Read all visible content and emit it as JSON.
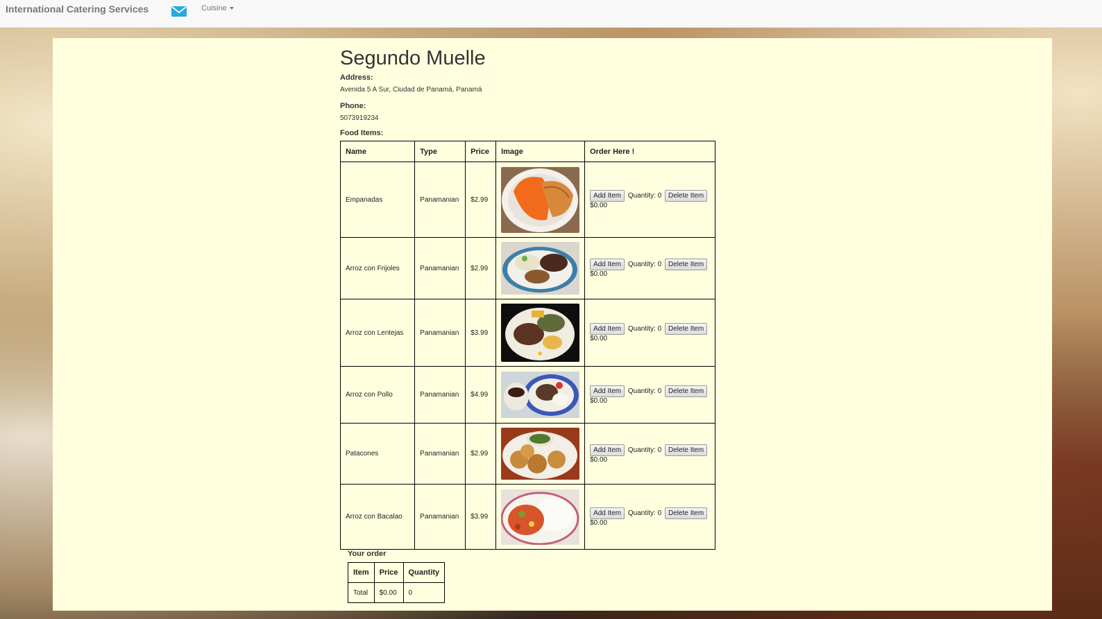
{
  "nav": {
    "brand": "International Catering Services",
    "mail_icon": "envelope-icon",
    "cuisine_label": "Cuisine"
  },
  "restaurant": {
    "name": "Segundo Muelle",
    "address_label": "Address:",
    "address": "Avenida 5 A Sur, Ciudad de Panamá, Panamá",
    "phone_label": "Phone:",
    "phone": "5073919234",
    "food_label": "Food Items:"
  },
  "food_table": {
    "headers": [
      "Name",
      "Type",
      "Price",
      "Image",
      "Order Here !"
    ],
    "add_label": "Add Item",
    "delete_label": "Delete Item",
    "rows": [
      {
        "name": "Empanadas",
        "type": "Panamanian",
        "price": "$2.99",
        "quantity": "Quantity: 0",
        "subtotal": "$0.00"
      },
      {
        "name": "Arroz con Frijoles",
        "type": "Panamanian",
        "price": "$2.99",
        "quantity": "Quantity: 0",
        "subtotal": "$0.00"
      },
      {
        "name": "Arroz con Lentejas",
        "type": "Panamanian",
        "price": "$3.99",
        "quantity": "Quantity: 0",
        "subtotal": "$0.00"
      },
      {
        "name": "Arroz con Pollo",
        "type": "Panamanian",
        "price": "$4.99",
        "quantity": "Quantity: 0",
        "subtotal": "$0.00"
      },
      {
        "name": "Patacones",
        "type": "Panamanian",
        "price": "$2.99",
        "quantity": "Quantity: 0",
        "subtotal": "$0.00"
      },
      {
        "name": "Arroz con Bacalao",
        "type": "Panamanian",
        "price": "$3.99",
        "quantity": "Quantity: 0",
        "subtotal": "$0.00"
      }
    ]
  },
  "order": {
    "title": "Your order",
    "headers": [
      "Item",
      "Price",
      "Quantity"
    ],
    "total_row": [
      "Total",
      "$0.00",
      "0"
    ]
  },
  "colors": {
    "panel_bg": "#ffffe0",
    "nav_bg": "#f8f8f8",
    "mail_icon": "#29a8e0"
  }
}
